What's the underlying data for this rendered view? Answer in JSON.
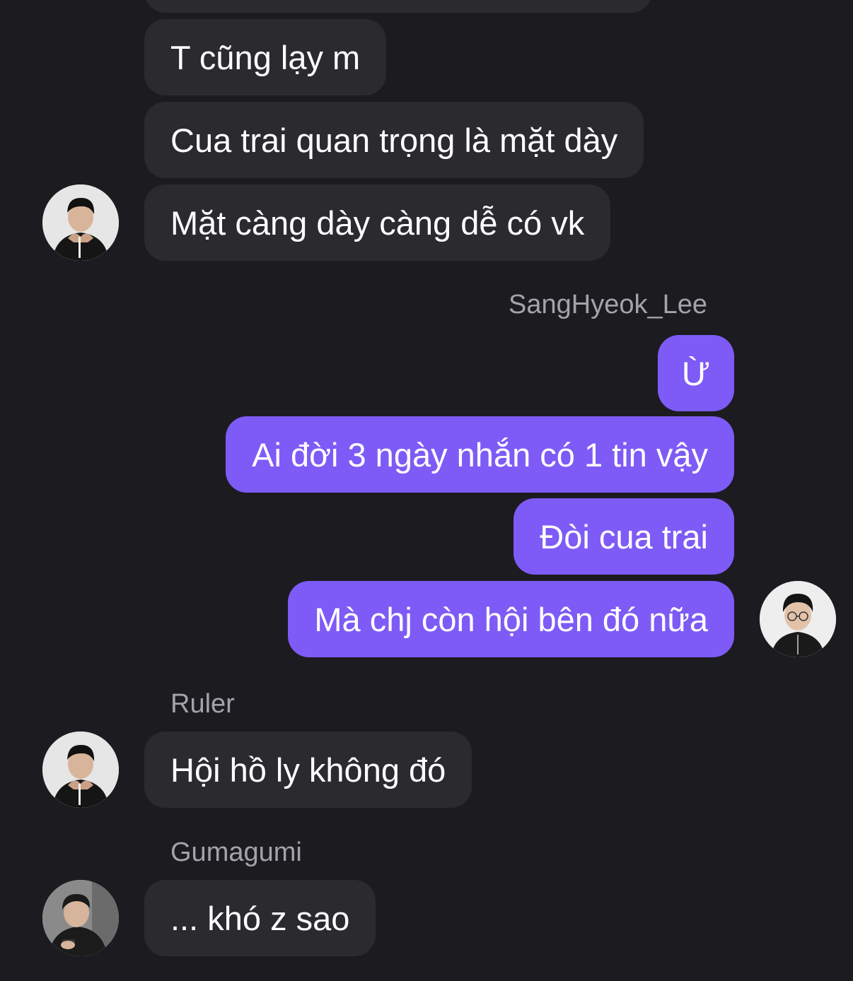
{
  "conversation": {
    "accent_color": "#7e5bf6",
    "incoming_bubble_color": "#2b2a2f",
    "background_color": "#1c1b20",
    "messages": [
      {
        "text": "T cũng lạy m"
      },
      {
        "text": "Cua trai quan trọng là mặt dày"
      },
      {
        "text": "Mặt càng dày càng dễ có vk"
      },
      {
        "sender": "SangHyeok_Lee"
      },
      {
        "text": "Ừ"
      },
      {
        "text": "Ai đời 3 ngày nhắn có 1 tin vậy"
      },
      {
        "text": "Đòi cua trai"
      },
      {
        "text": "Mà chj còn hội bên đó nữa"
      },
      {
        "sender": "Ruler"
      },
      {
        "text": "Hội hồ ly không đó"
      },
      {
        "sender": "Gumagumi"
      },
      {
        "text": "... khó z sao"
      }
    ]
  }
}
